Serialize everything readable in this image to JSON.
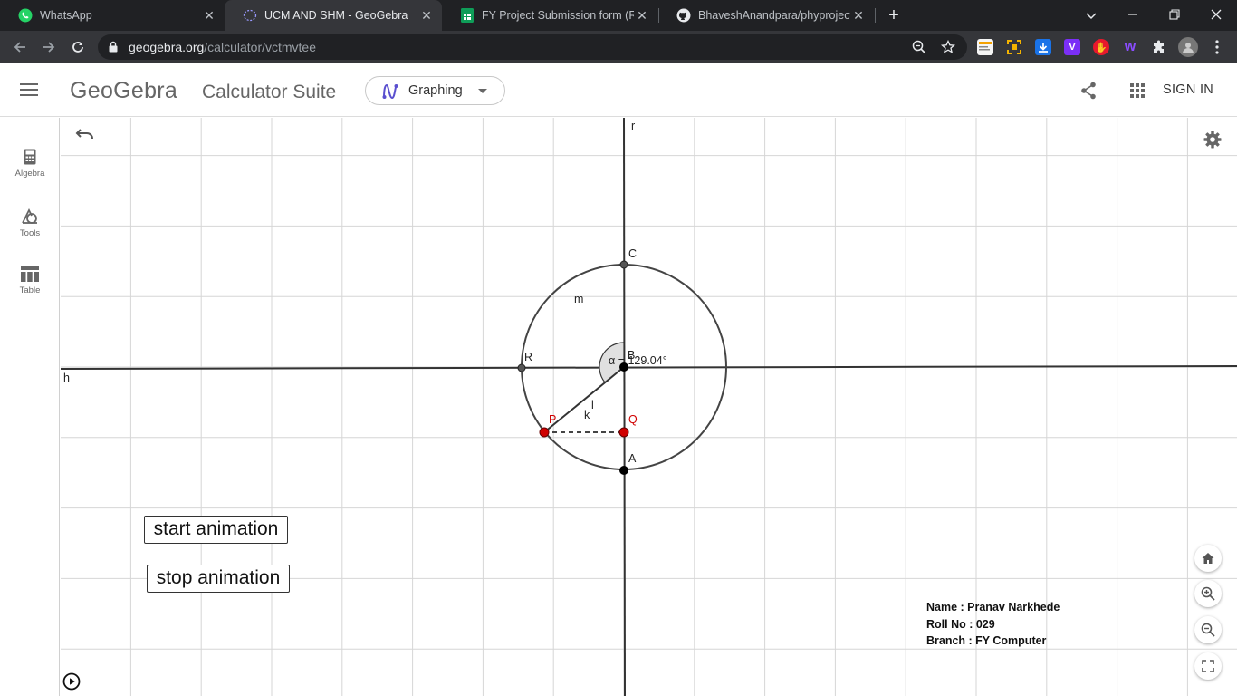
{
  "browser": {
    "tabs": [
      {
        "title": "WhatsApp",
        "icon": "whatsapp-icon",
        "active": false
      },
      {
        "title": "UCM AND SHM - GeoGebra",
        "icon": "geogebra-icon",
        "active": true
      },
      {
        "title": "FY Project Submission form (Resp",
        "icon": "google-sheets-icon",
        "active": false
      },
      {
        "title": "BhaveshAnandpara/phyproject: A",
        "icon": "github-icon",
        "active": false
      }
    ],
    "url_domain": "geogebra.org",
    "url_path": "/calculator/vctmvtee"
  },
  "header": {
    "logo": "GeoGebra",
    "suite": "Calculator Suite",
    "app_picker": "Graphing",
    "sign_in": "SIGN IN"
  },
  "sidebar": {
    "items": [
      {
        "label": "Algebra",
        "icon": "calculator-icon"
      },
      {
        "label": "Tools",
        "icon": "tools-icon"
      },
      {
        "label": "Table",
        "icon": "table-icon"
      }
    ]
  },
  "graph": {
    "axis_labels": {
      "vertical": "r",
      "horizontal": "h"
    },
    "points": {
      "C": "C",
      "R": "R",
      "B": "B",
      "P": "P",
      "Q": "Q",
      "A": "A"
    },
    "circle_label": "m",
    "segment_labels": {
      "l": "l",
      "k": "k"
    },
    "angle_label": "α = 129.04°",
    "colors": {
      "point_black": "#000000",
      "point_red": "#d00000",
      "label_red": "#d00000",
      "curve": "#444444",
      "angle_fill": "#e0e0e0"
    }
  },
  "buttons": {
    "start": "start animation",
    "stop": "stop animation"
  },
  "info": {
    "name": "Name : Pranav Narkhede",
    "roll": "Roll No : 029",
    "branch": "Branch : FY Computer"
  }
}
